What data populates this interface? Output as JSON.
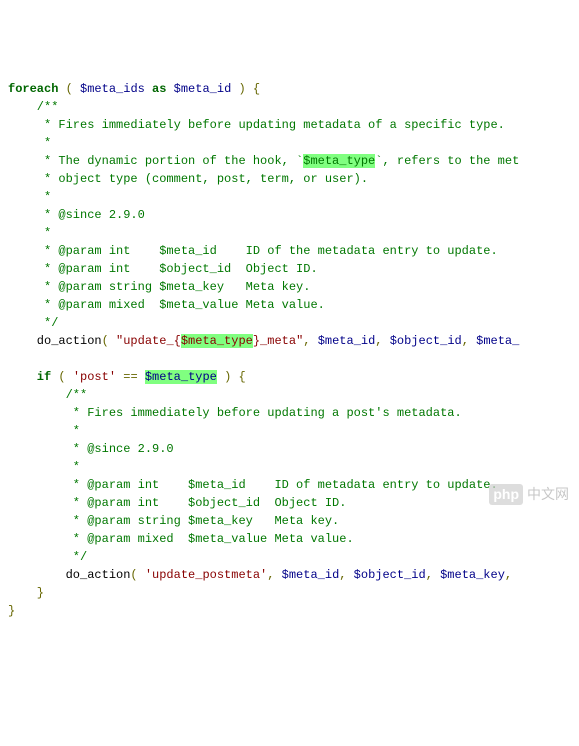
{
  "code": {
    "l1": {
      "kw": "foreach",
      "p1": " ( ",
      "v1": "$meta_ids",
      "kw2": " as ",
      "v2": "$meta_id",
      "p2": " ) {"
    },
    "l2": "    /**",
    "l3": "     * Fires immediately before updating metadata of a specific type.",
    "l4": "     *",
    "l5a": "     * The dynamic portion of the hook, `",
    "l5h": "$meta_type",
    "l5b": "`, refers to the met",
    "l6": "     * object type (comment, post, term, or user).",
    "l7": "     *",
    "l8": "     * @since 2.9.0",
    "l9": "     *",
    "l10": "     * @param int    $meta_id    ID of the metadata entry to update.",
    "l11": "     * @param int    $object_id  Object ID.",
    "l12": "     * @param string $meta_key   Meta key.",
    "l13": "     * @param mixed  $meta_value Meta value.",
    "l14": "     */",
    "l15fn": "    do_action",
    "l15p1": "( ",
    "l15s1": "\"update_{",
    "l15h": "$meta_type",
    "l15s2": "}_meta\"",
    "l15c1": ", ",
    "l15v1": "$meta_id",
    "l15c2": ", ",
    "l15v2": "$object_id",
    "l15c3": ", ",
    "l15v3": "$meta_",
    "blank": "",
    "l17kw": "    if",
    "l17p1": " ( ",
    "l17s": "'post'",
    "l17eq": " == ",
    "l17h": "$meta_type",
    "l17p2": " ) {",
    "l18": "        /**",
    "l19": "         * Fires immediately before updating a post's metadata.",
    "l20": "         *",
    "l21": "         * @since 2.9.0",
    "l22": "         *",
    "l23": "         * @param int    $meta_id    ID of metadata entry to update.",
    "l24": "         * @param int    $object_id  Object ID.",
    "l25": "         * @param string $meta_key   Meta key.",
    "l26": "         * @param mixed  $meta_value Meta value.",
    "l27": "         */",
    "l28fn": "        do_action",
    "l28p1": "( ",
    "l28s": "'update_postmeta'",
    "l28c1": ", ",
    "l28v1": "$meta_id",
    "l28c2": ", ",
    "l28v2": "$object_id",
    "l28c3": ", ",
    "l28v3": "$meta_key",
    "l28c4": ",",
    "l29": "    }",
    "l30": "}"
  },
  "watermark": {
    "p": "php",
    "text": "中文网"
  }
}
